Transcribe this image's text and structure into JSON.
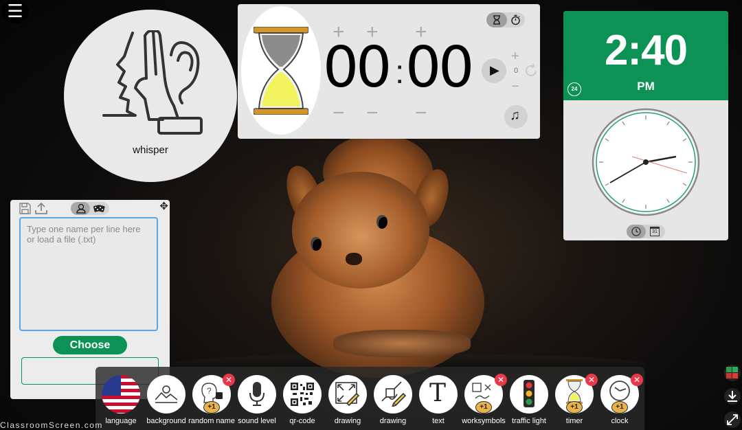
{
  "menu": {
    "icon": "hamburger-icon",
    "glyph": "☰"
  },
  "whisper": {
    "label": "whisper",
    "icon": "whisper-hand-ear-icon"
  },
  "timer": {
    "minutes": "00",
    "seconds": "00",
    "separator": ":",
    "repeat_count": "0",
    "plus": "+",
    "minus": "−",
    "play_glyph": "▶",
    "music_glyph": "♫",
    "modes": [
      "hourglass-icon",
      "stopwatch-icon"
    ]
  },
  "clock": {
    "time": "2:40",
    "ampm": "PM",
    "format_badge": "24",
    "calendar_day": "31",
    "accent": "#0b9254"
  },
  "random_name": {
    "placeholder": "Type one name per line here or load a file (.txt)",
    "choose_label": "Choose",
    "move_glyph": "✥"
  },
  "toolbar": {
    "items": [
      {
        "label": "language",
        "icon": "us-flag-icon",
        "removable": false
      },
      {
        "label": "background",
        "icon": "landscape-image-icon",
        "removable": false
      },
      {
        "label": "random name",
        "icon": "random-name-icon",
        "removable": true
      },
      {
        "label": "sound level",
        "icon": "microphone-icon",
        "removable": false
      },
      {
        "label": "qr-code",
        "icon": "qr-code-icon",
        "removable": false
      },
      {
        "label": "drawing",
        "icon": "drawing-fullscreen-icon",
        "removable": false
      },
      {
        "label": "drawing",
        "icon": "drawing-pencil-icon",
        "removable": false
      },
      {
        "label": "text",
        "icon": "text-t-icon",
        "removable": false
      },
      {
        "label": "worksymbols",
        "icon": "worksymbols-icon",
        "removable": true
      },
      {
        "label": "traffic light",
        "icon": "traffic-light-icon",
        "removable": false
      },
      {
        "label": "timer",
        "icon": "hourglass-icon",
        "removable": true
      },
      {
        "label": "clock",
        "icon": "clock-icon",
        "removable": true
      }
    ],
    "badge": "+1",
    "close_glyph": "✕"
  },
  "watermark": "ClassroomScreen.com",
  "colors": {
    "accent_green": "#0b9254",
    "close_red": "#e8394a",
    "focus_blue": "#5aa4e6"
  }
}
